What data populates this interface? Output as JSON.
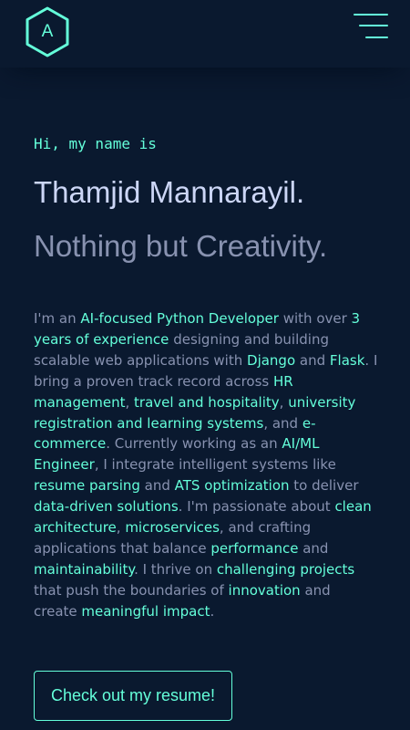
{
  "nav": {
    "logo_letter": "A",
    "menu_icon": "hamburger-menu-icon"
  },
  "hero": {
    "greeting": "Hi, my name is",
    "name": "Thamjid Mannarayil.",
    "tagline": "Nothing but Creativity.",
    "bio": [
      {
        "t": "I'm an ",
        "h": false
      },
      {
        "t": "AI-focused Python Developer",
        "h": true
      },
      {
        "t": " with over ",
        "h": false
      },
      {
        "t": "3 years of experience",
        "h": true
      },
      {
        "t": " designing and building scalable web applications with ",
        "h": false
      },
      {
        "t": "Django",
        "h": true
      },
      {
        "t": " and ",
        "h": false
      },
      {
        "t": "Flask",
        "h": true
      },
      {
        "t": ". I bring a proven track record across ",
        "h": false
      },
      {
        "t": "HR management",
        "h": true
      },
      {
        "t": ", ",
        "h": false
      },
      {
        "t": "travel and hospitality",
        "h": true
      },
      {
        "t": ", ",
        "h": false
      },
      {
        "t": "university registration and learning systems",
        "h": true
      },
      {
        "t": ", and ",
        "h": false
      },
      {
        "t": "e-commerce",
        "h": true
      },
      {
        "t": ". Currently working as an ",
        "h": false
      },
      {
        "t": "AI/ML Engineer",
        "h": true
      },
      {
        "t": ", I integrate intelligent systems like ",
        "h": false
      },
      {
        "t": "resume parsing",
        "h": true
      },
      {
        "t": " and ",
        "h": false
      },
      {
        "t": "ATS optimization",
        "h": true
      },
      {
        "t": " to deliver ",
        "h": false
      },
      {
        "t": "data-driven solutions",
        "h": true
      },
      {
        "t": ". I'm passionate about ",
        "h": false
      },
      {
        "t": "clean architecture",
        "h": true
      },
      {
        "t": ", ",
        "h": false
      },
      {
        "t": "microservices",
        "h": true
      },
      {
        "t": ", and crafting applications that balance ",
        "h": false
      },
      {
        "t": "performance",
        "h": true
      },
      {
        "t": " and ",
        "h": false
      },
      {
        "t": "maintainability",
        "h": true
      },
      {
        "t": ". I thrive on ",
        "h": false
      },
      {
        "t": "challenging projects",
        "h": true
      },
      {
        "t": " that push the boundaries of ",
        "h": false
      },
      {
        "t": "innovation",
        "h": true
      },
      {
        "t": " and create ",
        "h": false
      },
      {
        "t": "meaningful impact",
        "h": true
      },
      {
        "t": ".",
        "h": false
      }
    ],
    "cta_label": "Check out my resume!"
  },
  "colors": {
    "background": "#0a192f",
    "accent": "#64ffda",
    "heading": "#ccd6f6",
    "body_text": "#8892b0"
  }
}
